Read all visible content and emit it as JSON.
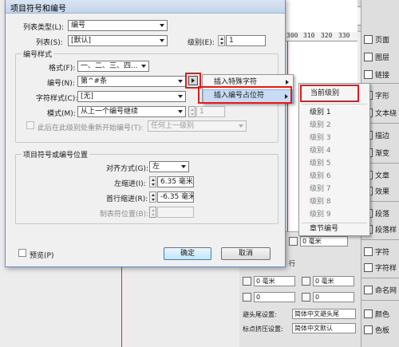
{
  "dialog": {
    "title": "项目符号和编号",
    "list_type_label": "列表类型(L):",
    "list_type_value": "编号",
    "list_label": "列表(S):",
    "list_value": "[默认]",
    "level_label": "级别(E):",
    "level_value": "1",
    "numbering_style_group": "编号样式",
    "format_label": "格式(F):",
    "format_value": "一、二、三、四...",
    "number_label": "编号(N):",
    "number_value": "第^#条",
    "char_style_label": "字符样式(C):",
    "char_style_value": "[无]",
    "mode_label": "模式(M):",
    "mode_value": "从上一个编号继续",
    "mode_number": "1",
    "restart_label": "此后在此级别处重新开始编号(T):",
    "restart_value": "任何上一级别",
    "position_group": "项目符号或编号位置",
    "align_label": "对齐方式(G):",
    "align_value": "左",
    "left_indent_label": "左缩进(I):",
    "left_indent_value": "6.35 毫米",
    "first_indent_label": "首行缩进(R):",
    "first_indent_value": "-6.35 毫米",
    "tab_label": "制表符位置(B):",
    "tab_value": "",
    "preview_label": "预览(P)",
    "ok_label": "确定",
    "cancel_label": "取消"
  },
  "menu1": {
    "items": [
      "插入特殊字符",
      "插入编号占位符"
    ]
  },
  "menu2": {
    "items": [
      "当前级别",
      "级别 1",
      "级别 2",
      "级别 3",
      "级别 4",
      "级别 5",
      "级别 6",
      "级别 7",
      "级别 8",
      "级别 9",
      "章节编号"
    ]
  },
  "ruler": {
    "ticks": [
      "300",
      "310",
      "320",
      "330"
    ]
  },
  "right_panel": {
    "items": [
      "页面",
      "图层",
      "链接",
      "字形",
      "文本绕",
      "描边",
      "渐变",
      "文章",
      "效果",
      "段落",
      "段落样",
      "字符",
      "字符样",
      "命名网",
      "颜色",
      "色板"
    ]
  },
  "bg_controls": {
    "unit": "毫米",
    "zero_value": "0 毫米",
    "row_label": "行",
    "field_value": "0",
    "avoid_label": "避头尾设置:",
    "avoid_value": "简体中文避头尾",
    "punct_label": "标点挤压设置:",
    "punct_value": "简体中文默认"
  },
  "colors": {
    "highlight": "#e01b1b",
    "menu_hover": "#c7dcf4",
    "title_bar": "#c3d4ea"
  }
}
